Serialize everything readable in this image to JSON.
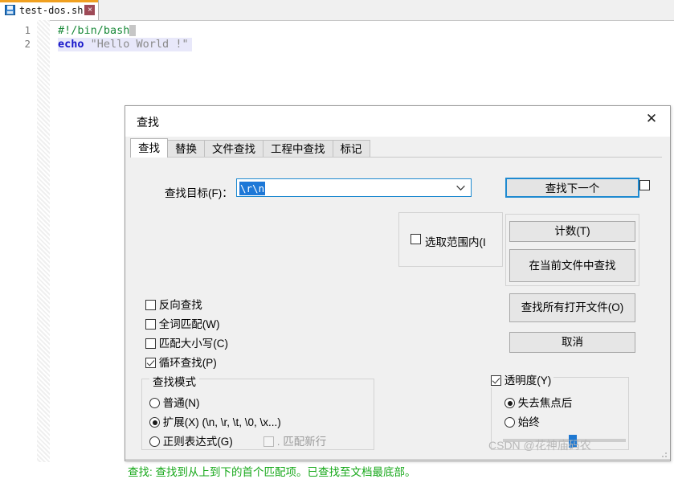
{
  "editor": {
    "tab": {
      "filename": "test-dos.sh",
      "save_icon": "floppy-disk-icon",
      "close_icon": "×"
    },
    "lines": [
      {
        "number": "1",
        "text": "#!/bin/bash"
      },
      {
        "number": "2",
        "keyword": "echo",
        "string": "\"Hello World !\""
      }
    ]
  },
  "dialog": {
    "title": "查找",
    "close_icon": "✕",
    "tabs": [
      {
        "label": "查找",
        "active": true
      },
      {
        "label": "替换",
        "active": false
      },
      {
        "label": "文件查找",
        "active": false
      },
      {
        "label": "工程中查找",
        "active": false
      },
      {
        "label": "标记",
        "active": false
      }
    ],
    "find": {
      "label": "查找目标(F)：",
      "value": "\\r\\n",
      "dropdown_icon": "chevron-down-icon"
    },
    "scope": {
      "label": "选取范围内(I",
      "checked": false
    },
    "buttons": {
      "find_next": "查找下一个",
      "count": "计数(T)",
      "find_in_file": "在当前文件中查找",
      "find_all_open": "查找所有打开文件(O)",
      "cancel": "取消"
    },
    "options": [
      {
        "label": "反向查找",
        "checked": false
      },
      {
        "label": "全词匹配(W)",
        "checked": false
      },
      {
        "label": "匹配大小写(C)",
        "checked": false
      },
      {
        "label": "循环查找(P)",
        "checked": true
      }
    ],
    "mode": {
      "legend": "查找模式",
      "items": [
        {
          "label": "普通(N)",
          "selected": false
        },
        {
          "label": "扩展(X) (\\n, \\r, \\t, \\0, \\x...)",
          "selected": true
        },
        {
          "label": "正则表达式(G)",
          "selected": false
        }
      ],
      "newline_checkbox": {
        "label": ". 匹配新行",
        "checked": false,
        "disabled": true
      }
    },
    "transparency": {
      "legend": "透明度(Y)",
      "checked": true,
      "items": [
        {
          "label": "失去焦点后",
          "selected": true
        },
        {
          "label": "始终",
          "selected": false
        }
      ],
      "slider_percent": 57
    },
    "status": "查找: 查找到从上到下的首个匹配项。已查找至文档最底部。"
  },
  "watermark": "CSDN @花神庙码农",
  "colors": {
    "accent": "#1f8ad0",
    "status_green": "#17a81a",
    "selection_blue": "#1e78d7",
    "tab_orange": "#f0a020"
  }
}
